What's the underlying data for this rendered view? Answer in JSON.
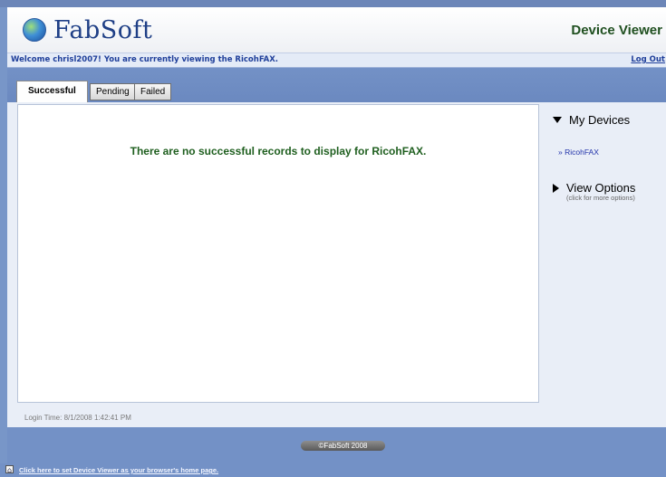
{
  "header": {
    "logo_text": "FabSoft",
    "title": "Device Viewer",
    "icon": "globe-icon"
  },
  "welcome": {
    "message": "Welcome chrisl2007! You are currently viewing the RicohFAX.",
    "logout_label": "Log Out"
  },
  "tabs": [
    {
      "label": "Successful",
      "active": true
    },
    {
      "label": "Pending",
      "active": false
    },
    {
      "label": "Failed",
      "active": false
    }
  ],
  "main": {
    "empty_message": "There are no successful records to display for RicohFAX.",
    "login_time": "Login Time: 8/1/2008 1:42:41 PM"
  },
  "sidebar": {
    "my_devices_label": "My Devices",
    "devices": [
      "» RicohFAX"
    ],
    "view_options_label": "View Options",
    "view_options_hint": "(click for more options)"
  },
  "footer": {
    "copyright": "©FabSoft 2008",
    "home_page_link": "Click here to set Device Viewer as your browser's home page."
  },
  "colors": {
    "background": "#7896c8",
    "welcome_bar": "#e4ebf7",
    "message_green": "#1f5f1f",
    "link_blue": "#1f3f9a"
  }
}
